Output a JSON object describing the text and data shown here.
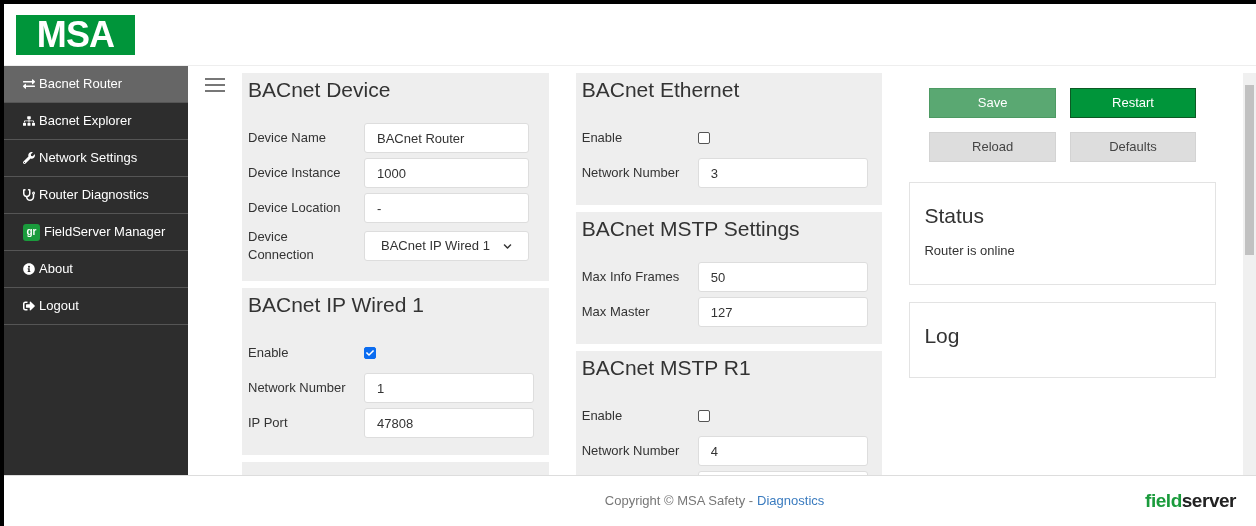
{
  "logo": {
    "text": "MSA"
  },
  "sidebar": {
    "items": [
      {
        "label": "Bacnet Router",
        "selected": true
      },
      {
        "label": "Bacnet Explorer",
        "selected": false
      },
      {
        "label": "Network Settings",
        "selected": false
      },
      {
        "label": "Router Diagnostics",
        "selected": false
      },
      {
        "label": "FieldServer Manager",
        "badge": "gr",
        "selected": false
      },
      {
        "label": "About",
        "selected": false
      },
      {
        "label": "Logout",
        "selected": false
      }
    ]
  },
  "columns": [
    [
      {
        "title": "BACnet Device",
        "fields": [
          {
            "kind": "text",
            "label": "Device Name",
            "value": "BACnet Router"
          },
          {
            "kind": "text",
            "label": "Device Instance",
            "value": "1000"
          },
          {
            "kind": "text",
            "label": "Device Location",
            "value": "-"
          },
          {
            "kind": "select",
            "label": "Device Connection",
            "value": "BACnet IP Wired 1"
          }
        ]
      },
      {
        "title": "BACnet IP Wired 1",
        "fields": [
          {
            "kind": "checkbox",
            "label": "Enable",
            "checked": true
          },
          {
            "kind": "text",
            "label": "Network Number",
            "value": "1"
          },
          {
            "kind": "text",
            "label": "IP Port",
            "value": "47808"
          }
        ]
      },
      {
        "kind": "clipped"
      }
    ],
    [
      {
        "title": "BACnet Ethernet",
        "fields": [
          {
            "kind": "checkbox",
            "label": "Enable",
            "checked": false
          },
          {
            "kind": "text",
            "label": "Network Number",
            "value": "3"
          }
        ]
      },
      {
        "title": "BACnet MSTP Settings",
        "fields": [
          {
            "kind": "text",
            "label": "Max Info Frames",
            "value": "50"
          },
          {
            "kind": "text",
            "label": "Max Master",
            "value": "127"
          }
        ]
      },
      {
        "title": "BACnet MSTP R1",
        "fields": [
          {
            "kind": "checkbox",
            "label": "Enable",
            "checked": false
          },
          {
            "kind": "text",
            "label": "Network Number",
            "value": "4"
          },
          {
            "kind": "empty"
          }
        ]
      }
    ]
  ],
  "actions": [
    {
      "label": "Save",
      "kind": "light-green"
    },
    {
      "label": "Restart",
      "kind": "green"
    },
    {
      "label": "Reload",
      "kind": "grey"
    },
    {
      "label": "Defaults",
      "kind": "grey"
    }
  ],
  "status": {
    "title": "Status",
    "text": "Router is online"
  },
  "log": {
    "title": "Log"
  },
  "footer": {
    "copyright": "Copyright © MSA Safety -",
    "link": "Diagnostics",
    "brand_a": "field",
    "brand_b": "server"
  }
}
